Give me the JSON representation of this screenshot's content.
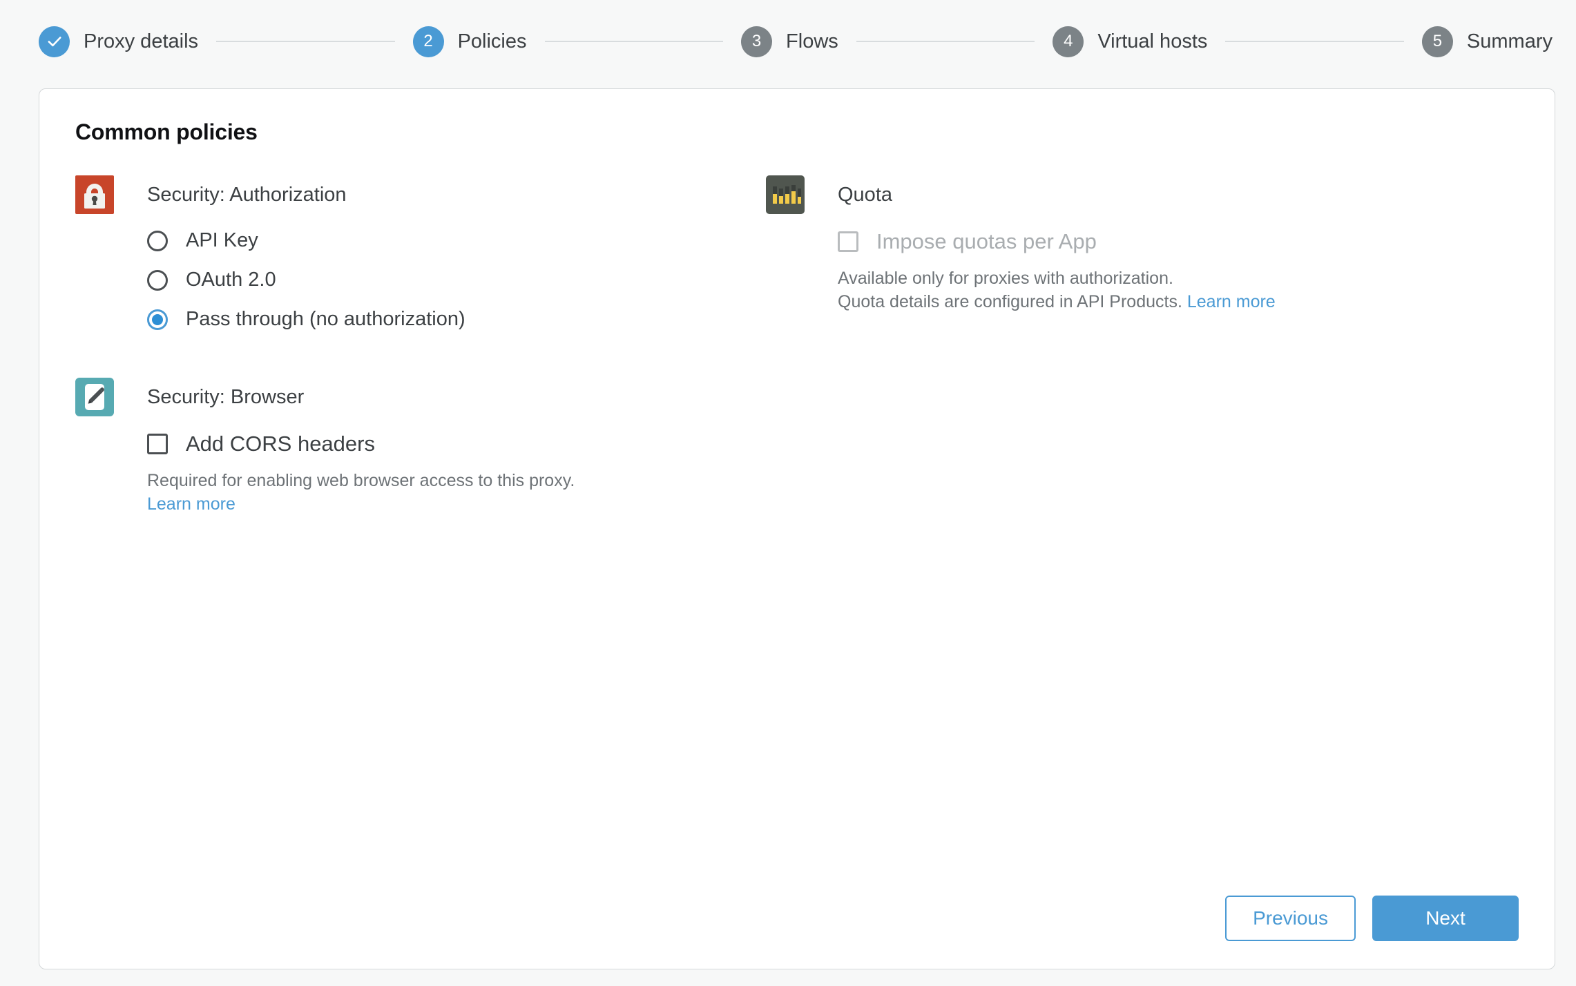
{
  "stepper": {
    "steps": [
      {
        "badge": "check",
        "label": "Proxy details",
        "state": "done"
      },
      {
        "badge": "2",
        "label": "Policies",
        "state": "active"
      },
      {
        "badge": "3",
        "label": "Flows",
        "state": "pending"
      },
      {
        "badge": "4",
        "label": "Virtual hosts",
        "state": "pending"
      },
      {
        "badge": "5",
        "label": "Summary",
        "state": "pending"
      }
    ]
  },
  "card": {
    "title": "Common policies",
    "policies": {
      "authorization": {
        "icon": "lock-icon",
        "icon_color": "#c8452a",
        "name": "Security: Authorization",
        "options": [
          {
            "label": "API Key",
            "selected": false
          },
          {
            "label": "OAuth 2.0",
            "selected": false
          },
          {
            "label": "Pass through (no authorization)",
            "selected": true
          }
        ]
      },
      "browser": {
        "icon": "pencil-icon",
        "icon_color": "#57aab2",
        "name": "Security: Browser",
        "checkbox_label": "Add CORS headers",
        "checked": false,
        "helper_text": "Required for enabling web browser access to this proxy.",
        "link_label": "Learn more"
      },
      "quota": {
        "icon": "bar-chart-icon",
        "icon_color": "#50564f",
        "name": "Quota",
        "checkbox_label": "Impose quotas per App",
        "checked": false,
        "disabled": true,
        "helper_line1": "Available only for proxies with authorization.",
        "helper_line2": "Quota details are configured in API Products.",
        "link_label": "Learn more"
      }
    },
    "footer": {
      "previous_label": "Previous",
      "next_label": "Next"
    }
  },
  "colors": {
    "accent": "#4a9ad4",
    "page_background": "#f7f8f8",
    "card_background": "#ffffff",
    "pending_step": "#7c8387",
    "text": "#3c4043",
    "muted_text": "#6e7377"
  }
}
